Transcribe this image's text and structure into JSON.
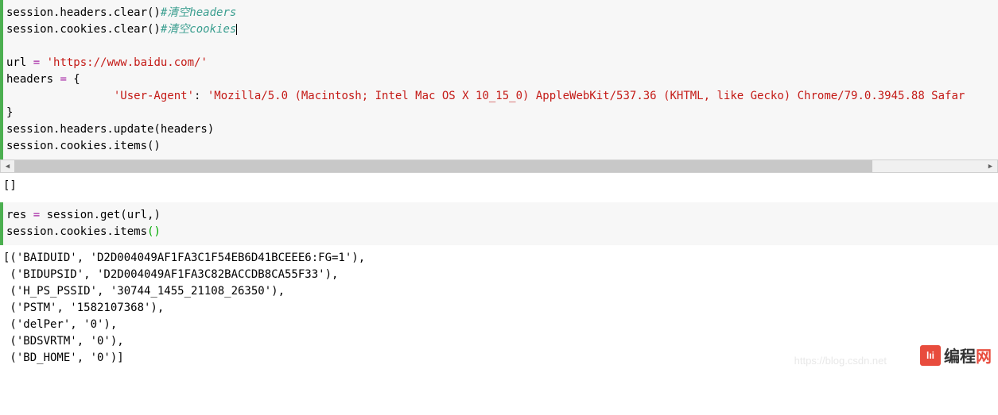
{
  "code1": {
    "line1_a": "session.headers.clear()",
    "line1_comment": "#清空headers",
    "line2_a": "session.cookies.clear()",
    "line2_comment": "#清空cookies",
    "line_blank": "",
    "line3_var": "url ",
    "line3_op": "=",
    "line3_str": " 'https://www.baidu.com/'",
    "line4_a": "headers ",
    "line4_op": "=",
    "line4_b": " {",
    "line5_indent": "                ",
    "line5_key": "'User-Agent'",
    "line5_colon": ": ",
    "line5_val": "'Mozilla/5.0 (Macintosh; Intel Mac OS X 10_15_0) AppleWebKit/537.36 (KHTML, like Gecko) Chrome/79.0.3945.88 Safar",
    "line6": "}",
    "line7": "session.headers.update(headers)",
    "line8": "session.cookies.items()"
  },
  "output1": "[]",
  "code2": {
    "line1_a": "res ",
    "line1_op": "=",
    "line1_b": " session.get(url,)",
    "line2_a": "session.cookies.items",
    "line2_paren": "()"
  },
  "output2": {
    "l1": "[('BAIDUID', 'D2D004049AF1FA3C1F54EB6D41BCEEE6:FG=1'),",
    "l2": " ('BIDUPSID', 'D2D004049AF1FA3C82BACCDB8CA55F33'),",
    "l3": " ('H_PS_PSSID', '30744_1455_21108_26350'),",
    "l4": " ('PSTM', '1582107368'),",
    "l5": " ('delPer', '0'),",
    "l6": " ('BDSVRTM', '0'),",
    "l7": " ('BD_HOME', '0')]"
  },
  "watermark": "https://blog.csdn.net",
  "logo": {
    "badge": "lıi",
    "text_a": "编程",
    "text_b": "网"
  }
}
